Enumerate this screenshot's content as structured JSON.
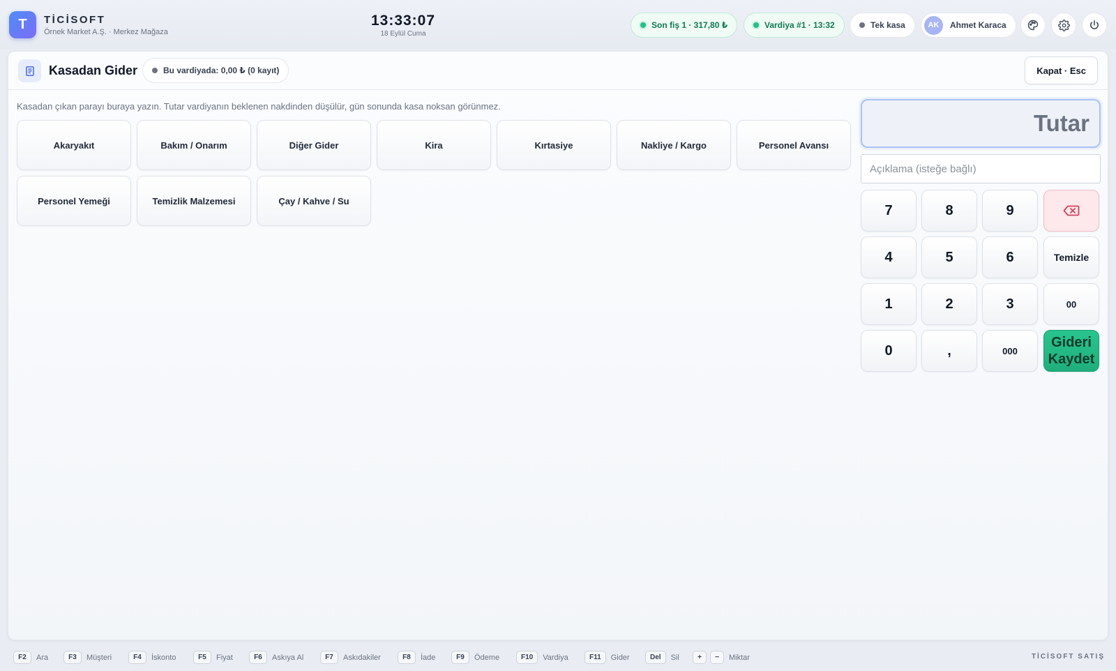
{
  "header": {
    "logo_letter": "T",
    "brand_name": "TİCİSOFT",
    "brand_sub": "Örnek Market A.Ş. · Merkez Mağaza",
    "time": "13:33:07",
    "date": "18 Eylül Cuma",
    "last_receipt": "Son fiş 1 · 317,80 ₺",
    "shift": "Vardiya #1 · 13:32",
    "register": "Tek kasa",
    "user_initials": "AK",
    "user_name": "Ahmet Karaca",
    "icons": [
      "palette-icon",
      "gear-icon",
      "power-icon"
    ]
  },
  "panel": {
    "title": "Kasadan Gider",
    "badge": "Bu vardiyada: 0,00 ₺ (0 kayıt)",
    "close_label": "Kapat · Esc",
    "hint": "Kasadan çıkan parayı buraya yazın. Tutar vardiyanın beklenen nakdinden düşülür, gün sonunda kasa noksan görünmez.",
    "categories": [
      "Akaryakıt",
      "Bakım / Onarım",
      "Diğer Gider",
      "Kira",
      "Kırtasiye",
      "Nakliye / Kargo",
      "Personel Avansı",
      "Personel Yemeği",
      "Temizlik Malzemesi",
      "Çay / Kahve / Su"
    ]
  },
  "keypad": {
    "amount_placeholder": "Tutar",
    "description_placeholder": "Açıklama (isteğe bağlı)",
    "keys": {
      "k7": "7",
      "k8": "8",
      "k9": "9",
      "k4": "4",
      "k5": "5",
      "k6": "6",
      "k1": "1",
      "k2": "2",
      "k3": "3",
      "k0": "0",
      "comma": ",",
      "k000": "000",
      "k00": "00",
      "clear": "Temizle",
      "save_line1": "Gideri",
      "save_line2": "Kaydet"
    }
  },
  "footer": {
    "shortcuts": [
      {
        "keys": [
          "F2"
        ],
        "label": "Ara"
      },
      {
        "keys": [
          "F3"
        ],
        "label": "Müşteri"
      },
      {
        "keys": [
          "F4"
        ],
        "label": "İskonto"
      },
      {
        "keys": [
          "F5"
        ],
        "label": "Fiyat"
      },
      {
        "keys": [
          "F6"
        ],
        "label": "Askıya Al"
      },
      {
        "keys": [
          "F7"
        ],
        "label": "Askıdakiler"
      },
      {
        "keys": [
          "F8"
        ],
        "label": "İade"
      },
      {
        "keys": [
          "F9"
        ],
        "label": "Ödeme"
      },
      {
        "keys": [
          "F10"
        ],
        "label": "Vardiya"
      },
      {
        "keys": [
          "F11"
        ],
        "label": "Gider"
      },
      {
        "keys": [
          "Del"
        ],
        "label": "Sil"
      },
      {
        "keys": [
          "+",
          "−"
        ],
        "label": "Miktar"
      }
    ],
    "brand": "TİCİSOFT SATIŞ"
  },
  "colors": {
    "accent_blue": "#4f8df7",
    "success_green": "#22c08a",
    "save_button": "#1fae7c",
    "delete_key": "#fde8ec"
  }
}
